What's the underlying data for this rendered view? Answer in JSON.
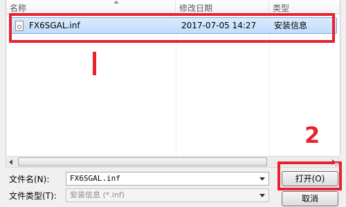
{
  "file_list": {
    "columns": [
      "名称",
      "修改日期",
      "类型"
    ],
    "files": [
      {
        "name": "FX6SGAL.inf",
        "modified": "2017-07-05 14:27",
        "type": "安装信息",
        "selected": true
      }
    ]
  },
  "annotations": {
    "mark_2": "2"
  },
  "form": {
    "filename_label": "文件名(N):",
    "filename_value": "FX6SGAL.inf",
    "filetype_label": "文件类型(T):",
    "filetype_value": "安装信息 (*.inf)"
  },
  "buttons": {
    "open": "打开(O)",
    "cancel": "取消"
  },
  "colors": {
    "annotation_red": "#e8212e",
    "selection_blue": "#c1dcfc"
  }
}
